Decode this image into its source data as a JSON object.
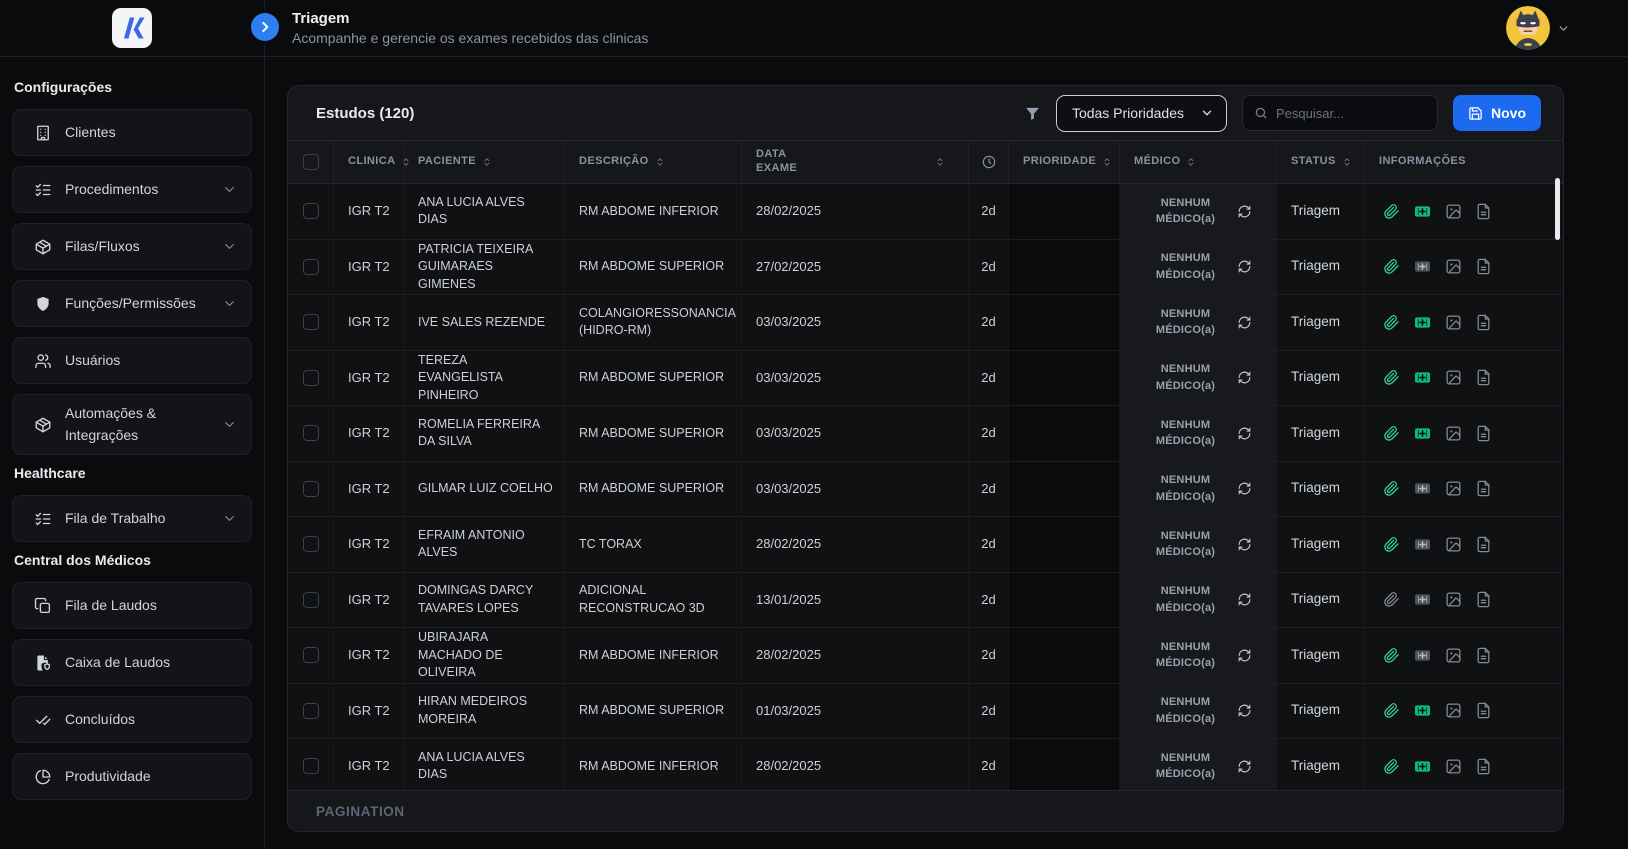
{
  "brand": {
    "logo_glyph": "K",
    "logo_color": "#3e68e7"
  },
  "topbar": {
    "title": "Triagem",
    "subtitle": "Acompanhe e gerencie os exames recebidos das clinicas",
    "collapse_icon": "chevron-right-icon",
    "user": {
      "avatar": "batman-avatar",
      "chevron": "chevron-down-icon"
    }
  },
  "sidebar": {
    "sections": [
      {
        "label": "Configurações",
        "items": [
          {
            "label": "Clientes",
            "icon": "building-icon",
            "chevron": false
          },
          {
            "label": "Procedimentos",
            "icon": "list-checks-icon",
            "chevron": true
          },
          {
            "label": "Filas/Fluxos",
            "icon": "package-icon",
            "chevron": true
          },
          {
            "label": "Funções/Permissões",
            "icon": "shield-icon",
            "chevron": true
          },
          {
            "label": "Usuários",
            "icon": "users-icon",
            "chevron": false
          },
          {
            "label": "Automações & Integrações",
            "icon": "package-icon",
            "chevron": true
          }
        ]
      },
      {
        "label": "Healthcare",
        "items": [
          {
            "label": "Fila de Trabalho",
            "icon": "list-checks-icon",
            "chevron": true
          }
        ]
      },
      {
        "label": "Central dos Médicos",
        "items": [
          {
            "label": "Fila de Laudos",
            "icon": "copy-icon",
            "chevron": false
          },
          {
            "label": "Caixa de Laudos",
            "icon": "file-shield-icon",
            "chevron": false
          },
          {
            "label": "Concluídos",
            "icon": "double-check-icon",
            "chevron": false
          },
          {
            "label": "Produtividade",
            "icon": "pie-chart-icon",
            "chevron": false
          }
        ]
      }
    ]
  },
  "toolbar": {
    "studies_title": "Estudos (120)",
    "filter_icon": "funnel-icon",
    "priority_filter": "Todas Prioridades",
    "search_placeholder": "Pesquisar...",
    "new_button": "Novo"
  },
  "table": {
    "columns": [
      {
        "key": "select",
        "checkbox": true
      },
      {
        "key": "clinica",
        "label": "CLINICA",
        "sortable": true
      },
      {
        "key": "paciente",
        "label": "PACIENTE",
        "sortable": true
      },
      {
        "key": "descricao",
        "label": "DESCRIÇÃO",
        "sortable": true
      },
      {
        "key": "data-exame",
        "label": "DATA EXAME",
        "sortable": true,
        "grow": true
      },
      {
        "key": "tempo",
        "icon": "clock-icon"
      },
      {
        "key": "prioridade",
        "label": "PRIORIDADE",
        "sortable": true
      },
      {
        "key": "medico",
        "label": "MÉDICO",
        "sortable": true
      },
      {
        "key": "status",
        "label": "STATUS",
        "sortable": true
      },
      {
        "key": "informacoes",
        "label": "INFORMAÇÕES"
      }
    ],
    "rows": [
      {
        "clinic": "IGR T2",
        "patient": "ANA LUCIA ALVES DIAS",
        "description": "RM ABDOME INFERIOR",
        "exam_date": "28/02/2025",
        "age": "2d",
        "priority": "",
        "doctor": "NENHUM MÉDICO(a)",
        "status": "Triagem",
        "attachments": {
          "clip": "green",
          "kit": "green"
        }
      },
      {
        "clinic": "IGR T2",
        "patient": "PATRICIA TEIXEIRA GUIMARAES GIMENES",
        "description": "RM ABDOME SUPERIOR",
        "exam_date": "27/02/2025",
        "age": "2d",
        "priority": "",
        "doctor": "NENHUM MÉDICO(a)",
        "status": "Triagem",
        "attachments": {
          "clip": "green",
          "kit": "gray"
        }
      },
      {
        "clinic": "IGR T2",
        "patient": "IVE SALES REZENDE",
        "description": "COLANGIORESSONANCIA (HIDRO-RM)",
        "exam_date": "03/03/2025",
        "age": "2d",
        "priority": "",
        "doctor": "NENHUM MÉDICO(a)",
        "status": "Triagem",
        "attachments": {
          "clip": "green",
          "kit": "green"
        }
      },
      {
        "clinic": "IGR T2",
        "patient": "TEREZA EVANGELISTA PINHEIRO",
        "description": "RM ABDOME SUPERIOR",
        "exam_date": "03/03/2025",
        "age": "2d",
        "priority": "",
        "doctor": "NENHUM MÉDICO(a)",
        "status": "Triagem",
        "attachments": {
          "clip": "green",
          "kit": "green"
        }
      },
      {
        "clinic": "IGR T2",
        "patient": "ROMELIA FERREIRA DA SILVA",
        "description": "RM ABDOME SUPERIOR",
        "exam_date": "03/03/2025",
        "age": "2d",
        "priority": "",
        "doctor": "NENHUM MÉDICO(a)",
        "status": "Triagem",
        "attachments": {
          "clip": "green",
          "kit": "green"
        }
      },
      {
        "clinic": "IGR T2",
        "patient": "GILMAR LUIZ COELHO",
        "description": "RM ABDOME SUPERIOR",
        "exam_date": "03/03/2025",
        "age": "2d",
        "priority": "",
        "doctor": "NENHUM MÉDICO(a)",
        "status": "Triagem",
        "attachments": {
          "clip": "green",
          "kit": "gray"
        }
      },
      {
        "clinic": "IGR T2",
        "patient": "EFRAIM ANTONIO ALVES",
        "description": "TC TORAX",
        "exam_date": "28/02/2025",
        "age": "2d",
        "priority": "",
        "doctor": "NENHUM MÉDICO(a)",
        "status": "Triagem",
        "attachments": {
          "clip": "green",
          "kit": "gray"
        }
      },
      {
        "clinic": "IGR T2",
        "patient": "DOMINGAS DARCY TAVARES LOPES",
        "description": "ADICIONAL RECONSTRUCAO 3D",
        "exam_date": "13/01/2025",
        "age": "2d",
        "priority": "",
        "doctor": "NENHUM MÉDICO(a)",
        "status": "Triagem",
        "attachments": {
          "clip": "gray",
          "kit": "gray"
        }
      },
      {
        "clinic": "IGR T2",
        "patient": "UBIRAJARA MACHADO DE OLIVEIRA",
        "description": "RM ABDOME INFERIOR",
        "exam_date": "28/02/2025",
        "age": "2d",
        "priority": "",
        "doctor": "NENHUM MÉDICO(a)",
        "status": "Triagem",
        "attachments": {
          "clip": "green",
          "kit": "gray"
        }
      },
      {
        "clinic": "IGR T2",
        "patient": "HIRAN MEDEIROS MOREIRA",
        "description": "RM ABDOME SUPERIOR",
        "exam_date": "01/03/2025",
        "age": "2d",
        "priority": "",
        "doctor": "NENHUM MÉDICO(a)",
        "status": "Triagem",
        "attachments": {
          "clip": "green",
          "kit": "green"
        }
      },
      {
        "clinic": "IGR T2",
        "patient": "ANA LUCIA ALVES DIAS",
        "description": "RM ABDOME INFERIOR",
        "exam_date": "28/02/2025",
        "age": "2d",
        "priority": "",
        "doctor": "NENHUM MÉDICO(a)",
        "status": "Triagem",
        "attachments": {
          "clip": "green",
          "kit": "green"
        }
      }
    ],
    "info_icons": [
      "paperclip-icon",
      "medical-kit-icon",
      "image-icon",
      "document-icon"
    ]
  },
  "pagination": {
    "label": "PAGINATION"
  },
  "colors": {
    "accent_blue": "#1b6af0",
    "collapse_blue": "#2d7ff0",
    "green": "#36d399",
    "kit_green": "#10b981",
    "avatar_yellow": "#f2c53d"
  }
}
